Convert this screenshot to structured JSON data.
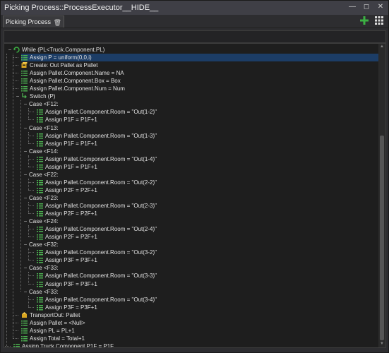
{
  "window": {
    "title": "Picking Process::ProcessExecutor__HIDE__"
  },
  "tab": {
    "label": "Picking Process"
  },
  "icons": {
    "add": "plus-icon",
    "grid": "grid-icon",
    "delete": "trash-icon",
    "assign": "assign-icon",
    "loop": "loop-icon",
    "switch": "switch-icon",
    "create": "create-icon",
    "transport": "transport-icon"
  },
  "colors": {
    "assign_green": "#4caf50",
    "selection": "#1c3d66",
    "add_green": "#3cb043"
  },
  "tree": [
    {
      "text": "While (PL<Truck.Component.PL)",
      "depth": 0,
      "icon": "loop",
      "expand": "-"
    },
    {
      "text": "Assign P = uniform(0,0,i)",
      "depth": 1,
      "icon": "assign",
      "selected": true
    },
    {
      "text": "Create: Out Pallet as Pallet",
      "depth": 1,
      "icon": "create"
    },
    {
      "text": "Assign Pallet.Component.Name = NA",
      "depth": 1,
      "icon": "assign"
    },
    {
      "text": "Assign Pallet.Component.Box = Box",
      "depth": 1,
      "icon": "assign"
    },
    {
      "text": "Assign Pallet.Component.Num = Num",
      "depth": 1,
      "icon": "assign"
    },
    {
      "text": "Switch (P)",
      "depth": 1,
      "icon": "switch",
      "expand": "-"
    },
    {
      "text": "Case <F12:",
      "depth": 2,
      "expand": "-"
    },
    {
      "text": "Assign Pallet.Component.Room = \"Out(1-2)\"",
      "depth": 3,
      "icon": "assign"
    },
    {
      "text": "Assign P1F = P1F+1",
      "depth": 3,
      "icon": "assign"
    },
    {
      "text": "Case <F13:",
      "depth": 2,
      "expand": "-"
    },
    {
      "text": "Assign Pallet.Component.Room = \"Out(1-3)\"",
      "depth": 3,
      "icon": "assign"
    },
    {
      "text": "Assign P1F = P1F+1",
      "depth": 3,
      "icon": "assign"
    },
    {
      "text": "Case <F14:",
      "depth": 2,
      "expand": "-"
    },
    {
      "text": "Assign Pallet.Component.Room = \"Out(1-4)\"",
      "depth": 3,
      "icon": "assign"
    },
    {
      "text": "Assign P1F = P1F+1",
      "depth": 3,
      "icon": "assign"
    },
    {
      "text": "Case <F22:",
      "depth": 2,
      "expand": "-"
    },
    {
      "text": "Assign Pallet.Component.Room = \"Out(2-2)\"",
      "depth": 3,
      "icon": "assign"
    },
    {
      "text": "Assign P2F = P2F+1",
      "depth": 3,
      "icon": "assign"
    },
    {
      "text": "Case <F23:",
      "depth": 2,
      "expand": "-"
    },
    {
      "text": "Assign Pallet.Component.Room = \"Out(2-3)\"",
      "depth": 3,
      "icon": "assign"
    },
    {
      "text": "Assign P2F = P2F+1",
      "depth": 3,
      "icon": "assign"
    },
    {
      "text": "Case <F24:",
      "depth": 2,
      "expand": "-"
    },
    {
      "text": "Assign Pallet.Component.Room = \"Out(2-4)\"",
      "depth": 3,
      "icon": "assign"
    },
    {
      "text": "Assign P2F = P2F+1",
      "depth": 3,
      "icon": "assign"
    },
    {
      "text": "Case <F32:",
      "depth": 2,
      "expand": "-"
    },
    {
      "text": "Assign Pallet.Component.Room = \"Out(3-2)\"",
      "depth": 3,
      "icon": "assign"
    },
    {
      "text": "Assign P3F = P3F+1",
      "depth": 3,
      "icon": "assign"
    },
    {
      "text": "Case <F33:",
      "depth": 2,
      "expand": "-"
    },
    {
      "text": "Assign Pallet.Component.Room = \"Out(3-3)\"",
      "depth": 3,
      "icon": "assign"
    },
    {
      "text": "Assign P3F = P3F+1",
      "depth": 3,
      "icon": "assign"
    },
    {
      "text": "Case <F33:",
      "depth": 2,
      "expand": "-"
    },
    {
      "text": "Assign Pallet.Component.Room = \"Out(3-4)\"",
      "depth": 3,
      "icon": "assign"
    },
    {
      "text": "Assign P3F = P3F+1",
      "depth": 3,
      "icon": "assign"
    },
    {
      "text": "TransportOut: Pallet",
      "depth": 1,
      "icon": "transport"
    },
    {
      "text": "Assign Pallet = <Null>",
      "depth": 1,
      "icon": "assign"
    },
    {
      "text": "Assign PL = PL+1",
      "depth": 1,
      "icon": "assign"
    },
    {
      "text": "Assign Total = Total+1",
      "depth": 1,
      "icon": "assign"
    },
    {
      "text": "Assign Truck.Component.P1F = P1F",
      "depth": 0,
      "icon": "assign"
    }
  ]
}
